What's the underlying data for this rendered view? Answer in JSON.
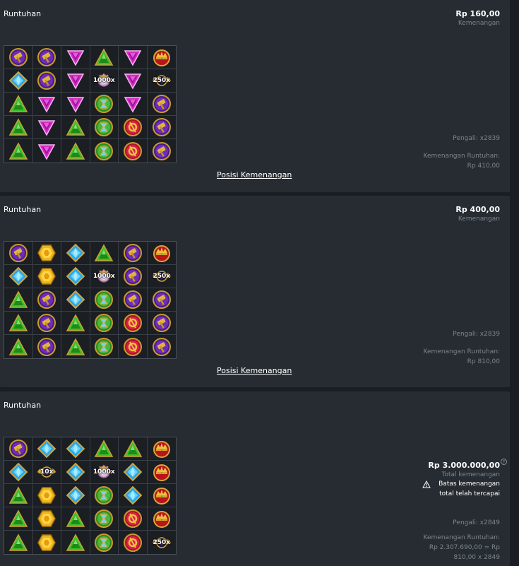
{
  "panels": [
    {
      "title": "Runtuhan",
      "amount": "Rp 160,00",
      "amount_label": "Kemenangan",
      "multiplier_text": "Pengali: x2839",
      "cascade_label": "Kemenangan Runtuhan:",
      "cascade_value": "Rp 410,00",
      "link": "Posisi Kemenangan",
      "grid": [
        [
          "hammer",
          "hammer",
          "pink",
          "green",
          "pink",
          "crown"
        ],
        [
          "blue",
          "hammer",
          "pink",
          "orb",
          "pink",
          "wing"
        ],
        [
          "green",
          "pink",
          "pink",
          "greenorb",
          "pink",
          "hammer"
        ],
        [
          "green",
          "pink",
          "green",
          "greenorb",
          "redorb",
          "hammer"
        ],
        [
          "green",
          "pink",
          "green",
          "greenorb",
          "redorb",
          "hammer"
        ]
      ],
      "multipliers": [
        {
          "r": 1,
          "c": 3,
          "text": "1000x"
        },
        {
          "r": 1,
          "c": 5,
          "text": "250x"
        }
      ]
    },
    {
      "title": "Runtuhan",
      "amount": "Rp 400,00",
      "amount_label": "Kemenangan",
      "multiplier_text": "Pengali: x2839",
      "cascade_label": "Kemenangan Runtuhan:",
      "cascade_value": "Rp 810,00",
      "link": "Posisi Kemenangan",
      "grid": [
        [
          "hammer",
          "yellow",
          "blue",
          "green",
          "hammer",
          "crown"
        ],
        [
          "blue",
          "yellow",
          "blue",
          "orb",
          "hammer",
          "wing"
        ],
        [
          "green",
          "hammer",
          "blue",
          "greenorb",
          "hammer",
          "hammer"
        ],
        [
          "green",
          "hammer",
          "green",
          "greenorb",
          "redorb",
          "hammer"
        ],
        [
          "green",
          "hammer",
          "green",
          "greenorb",
          "redorb",
          "hammer"
        ]
      ],
      "multipliers": [
        {
          "r": 1,
          "c": 3,
          "text": "1000x"
        },
        {
          "r": 1,
          "c": 5,
          "text": "250x"
        }
      ]
    },
    {
      "title": "Runtuhan",
      "amount": "Rp 3.000.000,00",
      "amount_label": "Total kemenangan",
      "warning_line1": "Batas kemenangan",
      "warning_line2": "total telah tercapai",
      "multiplier_text": "Pengali: x2849",
      "cascade_label": "Kemenangan Runtuhan:",
      "cascade_line2": "Rp 2.307.690,00 = Rp",
      "cascade_line3": "810,00 x 2849",
      "grid": [
        [
          "hammer",
          "blue",
          "blue",
          "green",
          "green",
          "crown"
        ],
        [
          "blue",
          "wing",
          "blue",
          "orb",
          "blue",
          "crown"
        ],
        [
          "green",
          "yellow",
          "blue",
          "greenorb",
          "blue",
          "crown"
        ],
        [
          "green",
          "yellow",
          "green",
          "greenorb",
          "redorb",
          "crown"
        ],
        [
          "green",
          "yellow",
          "green",
          "greenorb",
          "redorb",
          "wing"
        ]
      ],
      "multipliers": [
        {
          "r": 1,
          "c": 1,
          "text": "10x"
        },
        {
          "r": 1,
          "c": 3,
          "text": "1000x"
        },
        {
          "r": 4,
          "c": 5,
          "text": "250x"
        }
      ]
    }
  ],
  "icons": {
    "hammer": "hammer-of-zeus-icon",
    "pink": "pink-triangle-gem-icon",
    "green": "green-triangle-gem-icon",
    "blue": "blue-diamond-gem-icon",
    "yellow": "yellow-hexagon-gem-icon",
    "crown": "crown-icon",
    "orb": "multiplier-orb-icon",
    "greenorb": "green-hourglass-icon",
    "redorb": "red-ring-icon",
    "wing": "winged-orb-icon"
  },
  "colors": {
    "panel": "#262c31",
    "background": "#1a1e22",
    "muted": "#7d858c"
  }
}
